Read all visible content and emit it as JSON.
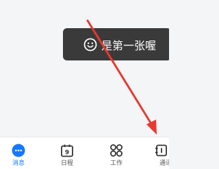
{
  "toast": {
    "text": "是第一张喔",
    "icon": "smiley-icon"
  },
  "annotation": {
    "arrow_color": "#e8392f"
  },
  "tabbar": {
    "active_color": "#1677ff",
    "items": [
      {
        "label": "消息",
        "icon": "chat-bubble-icon",
        "active": true
      },
      {
        "label": "日程",
        "icon": "calendar-icon",
        "active": false
      },
      {
        "label": "工作",
        "icon": "apps-grid-icon",
        "active": false
      },
      {
        "label": "通讯",
        "icon": "contacts-icon",
        "active": false
      }
    ]
  }
}
